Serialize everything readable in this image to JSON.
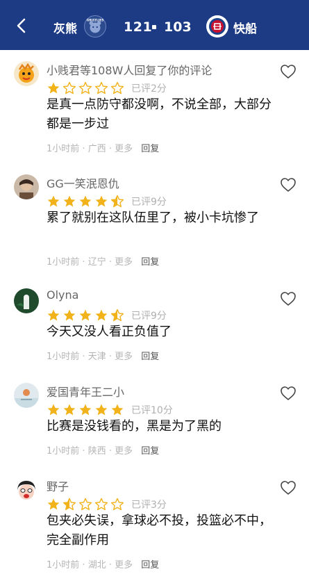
{
  "header": {
    "team_left": "灰熊",
    "team_left_logo_text": "GRIZZLIES",
    "score_left": "121",
    "score_right": "103",
    "team_right": "快船",
    "bg_color": "#1d3a84"
  },
  "comments": [
    {
      "username": "小贱君等108W人回复了你的评论",
      "stars": 1,
      "rated_text": "已评2分",
      "text": "是真一点防守都没啊，不说全部，大部分都是一步过",
      "time": "1小时前",
      "location": "广西",
      "more": "更多",
      "reply": "回复",
      "avatar_icon": "cartoon-avatar"
    },
    {
      "username": "GG一笑泯恩仇",
      "stars": 4.5,
      "rated_text": "已评9分",
      "text": "累了就别在这队伍里了，被小卡坑惨了",
      "time": "1小时前",
      "location": "辽宁",
      "more": "更多",
      "reply": "回复",
      "avatar_icon": "person-avatar"
    },
    {
      "username": "Olyna",
      "stars": 4.5,
      "rated_text": "已评9分",
      "text": "今天又没人看正负值了",
      "time": "1小时前",
      "location": "天津",
      "more": "更多",
      "reply": "回复",
      "avatar_icon": "green-avatar"
    },
    {
      "username": "爱国青年王二小",
      "stars": 5,
      "rated_text": "已评10分",
      "text": "比赛是没钱看的，黑是为了黑的",
      "time": "1小时前",
      "location": "陕西",
      "more": "更多",
      "reply": "回复",
      "avatar_icon": "landscape-avatar"
    },
    {
      "username": "野子",
      "stars": 1.5,
      "rated_text": "已评3分",
      "text": "包夹必失误，拿球必不投，投篮必不中，完全副作用",
      "time": "1小时前",
      "location": "湖北",
      "more": "更多",
      "reply": "回复",
      "avatar_icon": "cartoon-girl-avatar"
    }
  ],
  "colors": {
    "star_filled": "#f2b21a",
    "star_empty": "#f2b21a"
  }
}
